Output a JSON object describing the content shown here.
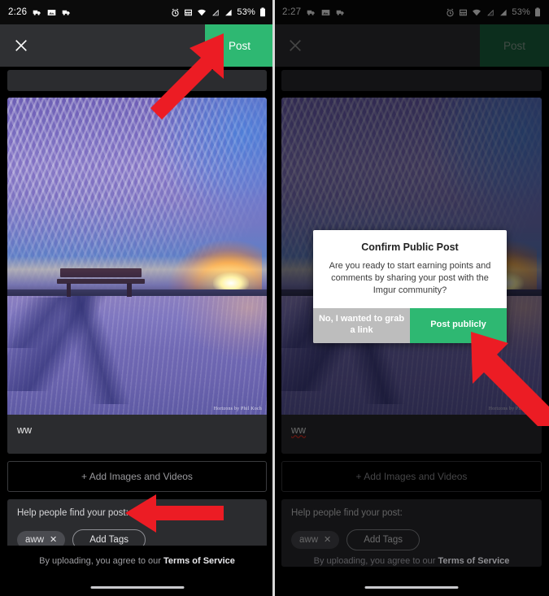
{
  "left": {
    "status": {
      "time": "2:26",
      "battery_pct": "53%",
      "icons": [
        "screenshot-icon",
        "image-icon",
        "screenshot-icon",
        "alarm-icon",
        "network-widget-icon",
        "wifi-icon",
        "signal-icon",
        "signal-icon",
        "battery-icon"
      ]
    },
    "actionbar": {
      "close_label": "✕",
      "post_label": "Post"
    },
    "photo": {
      "watermark": "Horizons by Phil Koch"
    },
    "caption": {
      "value": "ww"
    },
    "add_media_label": "+ Add Images and Videos",
    "tags": {
      "title": "Help people find your post:",
      "chips": [
        {
          "label": "aww",
          "remove": "✕"
        }
      ],
      "add_label": "Add Tags"
    },
    "tos": {
      "prefix": "By uploading, you agree to our ",
      "link": "Terms of Service"
    }
  },
  "right": {
    "status": {
      "time": "2:27",
      "battery_pct": "53%"
    },
    "actionbar": {
      "close_label": "✕",
      "post_label": "Post"
    },
    "photo": {
      "watermark": "Horizons by Phil Koch"
    },
    "caption": {
      "value": "ww"
    },
    "add_media_label": "+ Add Images and Videos",
    "tags": {
      "title": "Help people find your post:",
      "chips": [
        {
          "label": "aww",
          "remove": "✕"
        }
      ],
      "add_label": "Add Tags"
    },
    "tos": {
      "prefix": "By uploading, you agree to our ",
      "link": "Terms of Service"
    },
    "dialog": {
      "title": "Confirm Public Post",
      "message": "Are you ready to start earning points and comments by sharing your post with the Imgur community?",
      "cancel_label": "No, I wanted to grab a link",
      "confirm_label": "Post publicly"
    }
  },
  "colors": {
    "accent_green": "#2eb872",
    "post_button_green": "#2eb872",
    "arrow_red": "#ec1c24",
    "dialog_cancel_gray": "#bdbdbd",
    "action_bar": "#2f3033",
    "card": "#2b2c2f",
    "page_bg": "#000000"
  },
  "annotations": [
    {
      "name": "arrow-to-post-button",
      "target": "Post"
    },
    {
      "name": "arrow-to-add-tags",
      "target": "Add Tags"
    },
    {
      "name": "arrow-to-post-publicly",
      "target": "Post publicly"
    }
  ]
}
